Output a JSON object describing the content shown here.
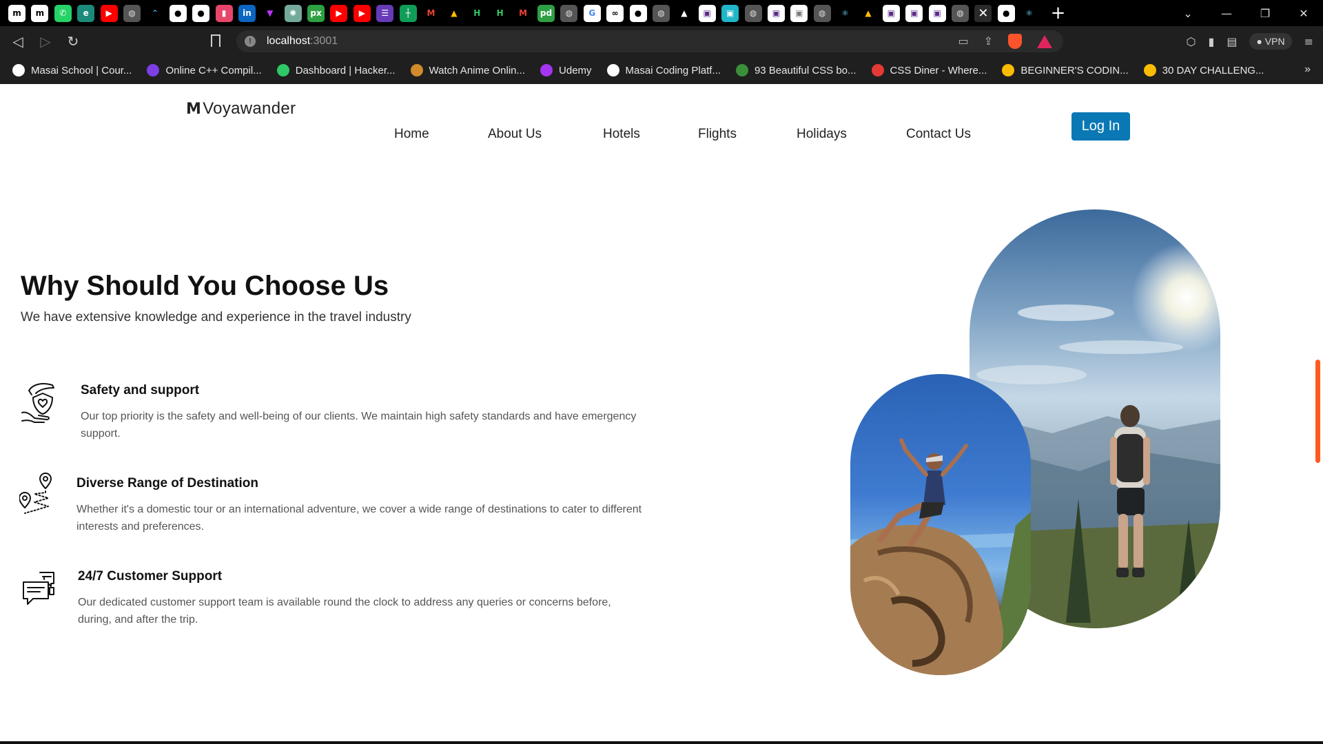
{
  "browser": {
    "tab_favicons": [
      {
        "name": "masai-tab-icon",
        "color": "#ffffff",
        "glyph": "m",
        "fg": "#000000"
      },
      {
        "name": "masai-tab-icon",
        "color": "#ffffff",
        "glyph": "m",
        "fg": "#000000"
      },
      {
        "name": "whatsapp-tab-icon",
        "color": "#25d366",
        "glyph": "✆",
        "fg": "#ffffff"
      },
      {
        "name": "edge-tab-icon",
        "color": "#1b8a7a",
        "glyph": "e",
        "fg": "#ffffff"
      },
      {
        "name": "youtube-tab-icon",
        "color": "#ff0000",
        "glyph": "▶",
        "fg": "#ffffff"
      },
      {
        "name": "globe-tab-icon",
        "color": "#555555",
        "glyph": "◍",
        "fg": "#dddddd"
      },
      {
        "name": "codeforces-tab-icon",
        "color": "#000000",
        "glyph": "⌃",
        "fg": "#4aa3df"
      },
      {
        "name": "github-tab-icon",
        "color": "#ffffff",
        "glyph": "●",
        "fg": "#000000"
      },
      {
        "name": "github-tab-icon",
        "color": "#ffffff",
        "glyph": "●",
        "fg": "#000000"
      },
      {
        "name": "pinterest-tab-icon",
        "color": "#e8456b",
        "glyph": "▮",
        "fg": "#ffffff"
      },
      {
        "name": "linkedin-tab-icon",
        "color": "#0a66c2",
        "glyph": "in",
        "fg": "#ffffff"
      },
      {
        "name": "vite-tab-icon",
        "color": "#000000",
        "glyph": "▼",
        "fg": "#bd34fe"
      },
      {
        "name": "chatgpt-tab-icon",
        "color": "#74aa9c",
        "glyph": "✺",
        "fg": "#ffffff"
      },
      {
        "name": "px-tab-icon",
        "color": "#2ea043",
        "glyph": "px",
        "fg": "#ffffff"
      },
      {
        "name": "youtube-tab-icon",
        "color": "#ff0000",
        "glyph": "▶",
        "fg": "#ffffff"
      },
      {
        "name": "youtube-tab-icon",
        "color": "#ff0000",
        "glyph": "▶",
        "fg": "#ffffff"
      },
      {
        "name": "forms-tab-icon",
        "color": "#673ab7",
        "glyph": "☰",
        "fg": "#ffffff"
      },
      {
        "name": "sheets-tab-icon",
        "color": "#0f9d58",
        "glyph": "┼",
        "fg": "#ffffff"
      },
      {
        "name": "gmail-tab-icon",
        "color": "#000000",
        "glyph": "M",
        "fg": "#ea4335"
      },
      {
        "name": "drive-tab-icon",
        "color": "#000000",
        "glyph": "▲",
        "fg": "#fbbc04"
      },
      {
        "name": "hackerrank-tab-icon",
        "color": "#000000",
        "glyph": "H",
        "fg": "#2ec866"
      },
      {
        "name": "hackerrank-tab-icon",
        "color": "#000000",
        "glyph": "H",
        "fg": "#2ec866"
      },
      {
        "name": "gmail-tab-icon",
        "color": "#000000",
        "glyph": "M",
        "fg": "#ea4335"
      },
      {
        "name": "pd-tab-icon",
        "color": "#2ea043",
        "glyph": "pd",
        "fg": "#ffffff"
      },
      {
        "name": "globe-tab-icon",
        "color": "#555555",
        "glyph": "◍",
        "fg": "#dddddd"
      },
      {
        "name": "google-tab-icon",
        "color": "#ffffff",
        "glyph": "G",
        "fg": "#4285f4"
      },
      {
        "name": "loop-tab-icon",
        "color": "#ffffff",
        "glyph": "∞",
        "fg": "#000000"
      },
      {
        "name": "github-tab-icon",
        "color": "#ffffff",
        "glyph": "●",
        "fg": "#000000"
      },
      {
        "name": "globe-tab-icon",
        "color": "#555555",
        "glyph": "◍",
        "fg": "#dddddd"
      },
      {
        "name": "triangle-tab-icon",
        "color": "#000000",
        "glyph": "▲",
        "fg": "#ffffff"
      },
      {
        "name": "app-tab-icon",
        "color": "#ffffff",
        "glyph": "▣",
        "fg": "#5b2a86"
      },
      {
        "name": "app-tab-icon",
        "color": "#1fb6c9",
        "glyph": "▣",
        "fg": "#ffffff"
      },
      {
        "name": "globe-tab-icon",
        "color": "#555555",
        "glyph": "◍",
        "fg": "#dddddd"
      },
      {
        "name": "app-tab-icon",
        "color": "#ffffff",
        "glyph": "▣",
        "fg": "#5b2a86"
      },
      {
        "name": "app-tab-icon",
        "color": "#ffffff",
        "glyph": "▣",
        "fg": "#777777"
      },
      {
        "name": "globe-tab-icon",
        "color": "#555555",
        "glyph": "◍",
        "fg": "#dddddd"
      },
      {
        "name": "react-tab-icon",
        "color": "#000000",
        "glyph": "⚛",
        "fg": "#61dafb"
      },
      {
        "name": "drive-tab-icon",
        "color": "#000000",
        "glyph": "▲",
        "fg": "#fbbc04"
      },
      {
        "name": "app-tab-icon",
        "color": "#ffffff",
        "glyph": "▣",
        "fg": "#5b2a86"
      },
      {
        "name": "app-tab-icon",
        "color": "#ffffff",
        "glyph": "▣",
        "fg": "#5b2a86"
      },
      {
        "name": "app-tab-icon",
        "color": "#ffffff",
        "glyph": "▣",
        "fg": "#5b2a86"
      },
      {
        "name": "globe-tab-icon",
        "color": "#555555",
        "glyph": "◍",
        "fg": "#dddddd"
      }
    ],
    "tab_favicons_after_active": [
      {
        "name": "github-tab-icon",
        "color": "#ffffff",
        "glyph": "●",
        "fg": "#000000"
      },
      {
        "name": "react-tab-icon",
        "color": "#000000",
        "glyph": "⚛",
        "fg": "#61dafb"
      }
    ],
    "url_host": "localhost",
    "url_port": ":3001",
    "vpn_label": "VPN",
    "bookmarks": [
      {
        "label": "Masai School | Cour...",
        "color": "#ffffff"
      },
      {
        "label": "Online C++ Compil...",
        "color": "#7b3fe4"
      },
      {
        "label": "Dashboard | Hacker...",
        "color": "#2ec866"
      },
      {
        "label": "Watch Anime Onlin...",
        "color": "#d18b2b"
      },
      {
        "label": "Udemy",
        "color": "#a435f0"
      },
      {
        "label": "Masai Coding Platf...",
        "color": "#ffffff"
      },
      {
        "label": "93 Beautiful CSS bo...",
        "color": "#3b8f3b"
      },
      {
        "label": "CSS Diner - Where...",
        "color": "#e53935"
      },
      {
        "label": "BEGINNER'S CODIN...",
        "color": "#fbbc04"
      },
      {
        "label": "30 DAY CHALLENG...",
        "color": "#fbbc04"
      }
    ]
  },
  "nav": {
    "logo_mark": "M",
    "logo_text": "Voyawander",
    "links": [
      "Home",
      "About Us",
      "Hotels",
      "Flights",
      "Holidays",
      "Contact Us"
    ],
    "login_label": "Log In"
  },
  "hero": {
    "title": "Why Should You Choose Us",
    "subtitle": "We have extensive knowledge and experience in the travel industry"
  },
  "features": [
    {
      "title": "Safety and support",
      "desc": "Our top priority is the safety and well-being of our clients. We maintain high safety standards and have emergency support."
    },
    {
      "title": "Diverse Range of Destination",
      "desc": "Whether it's a domestic tour or an international adventure, we cover a wide range of destinations to cater to different interests and preferences."
    },
    {
      "title": "24/7 Customer Support",
      "desc": "Our dedicated customer support team is available round the clock to address any queries or concerns before, during, and after the trip."
    }
  ],
  "colors": {
    "accent": "#0a78b4",
    "scroll_thumb": "#ff5a1f"
  }
}
